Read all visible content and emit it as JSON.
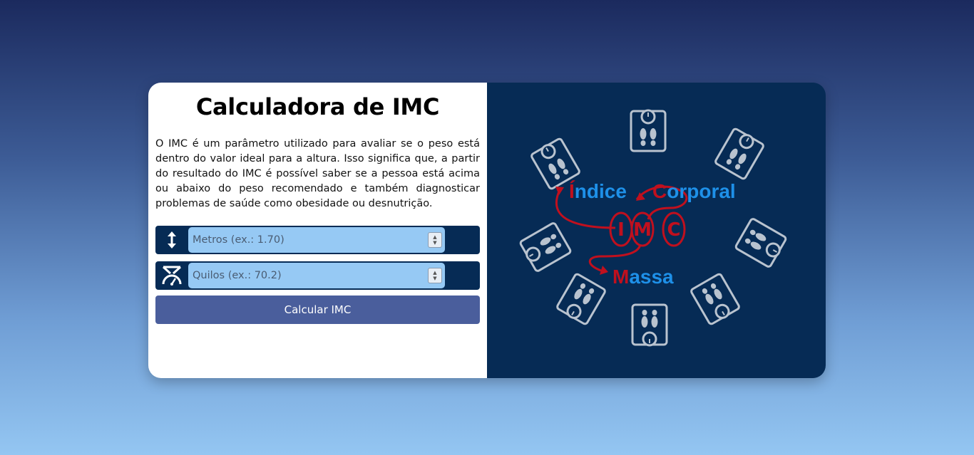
{
  "title": "Calculadora de IMC",
  "description": "O IMC é um parâmetro utilizado para avaliar se o peso está dentro do valor ideal para a altura. Isso significa que, a partir do resultado do IMC é possível saber se a pessoa está acima ou abaixo do peso recomendado e também diagnosticar problemas de saúde como obesidade ou desnutrição.",
  "height_field": {
    "placeholder": "Metros (ex.: 1.70)",
    "value": ""
  },
  "weight_field": {
    "placeholder": "Quilos (ex.: 70.2)",
    "value": ""
  },
  "calculate_button": "Calcular IMC",
  "illustration": {
    "word_indice_initial": "Í",
    "word_indice_rest": "ndice",
    "word_corporal_initial": "C",
    "word_corporal_rest": "orporal",
    "word_massa_initial": "M",
    "word_massa_rest": "assa",
    "letter_i": "I",
    "letter_m": "M",
    "letter_c": "C"
  },
  "colors": {
    "accent_dark": "#062b55",
    "input_bg": "#96c9f4",
    "button_bg": "#4a5e9c",
    "illustration_red": "#c0101e",
    "illustration_blue": "#1e90e8"
  },
  "icons": [
    "height-arrows-icon",
    "scale-icon",
    "bathroom-scale-icon"
  ]
}
